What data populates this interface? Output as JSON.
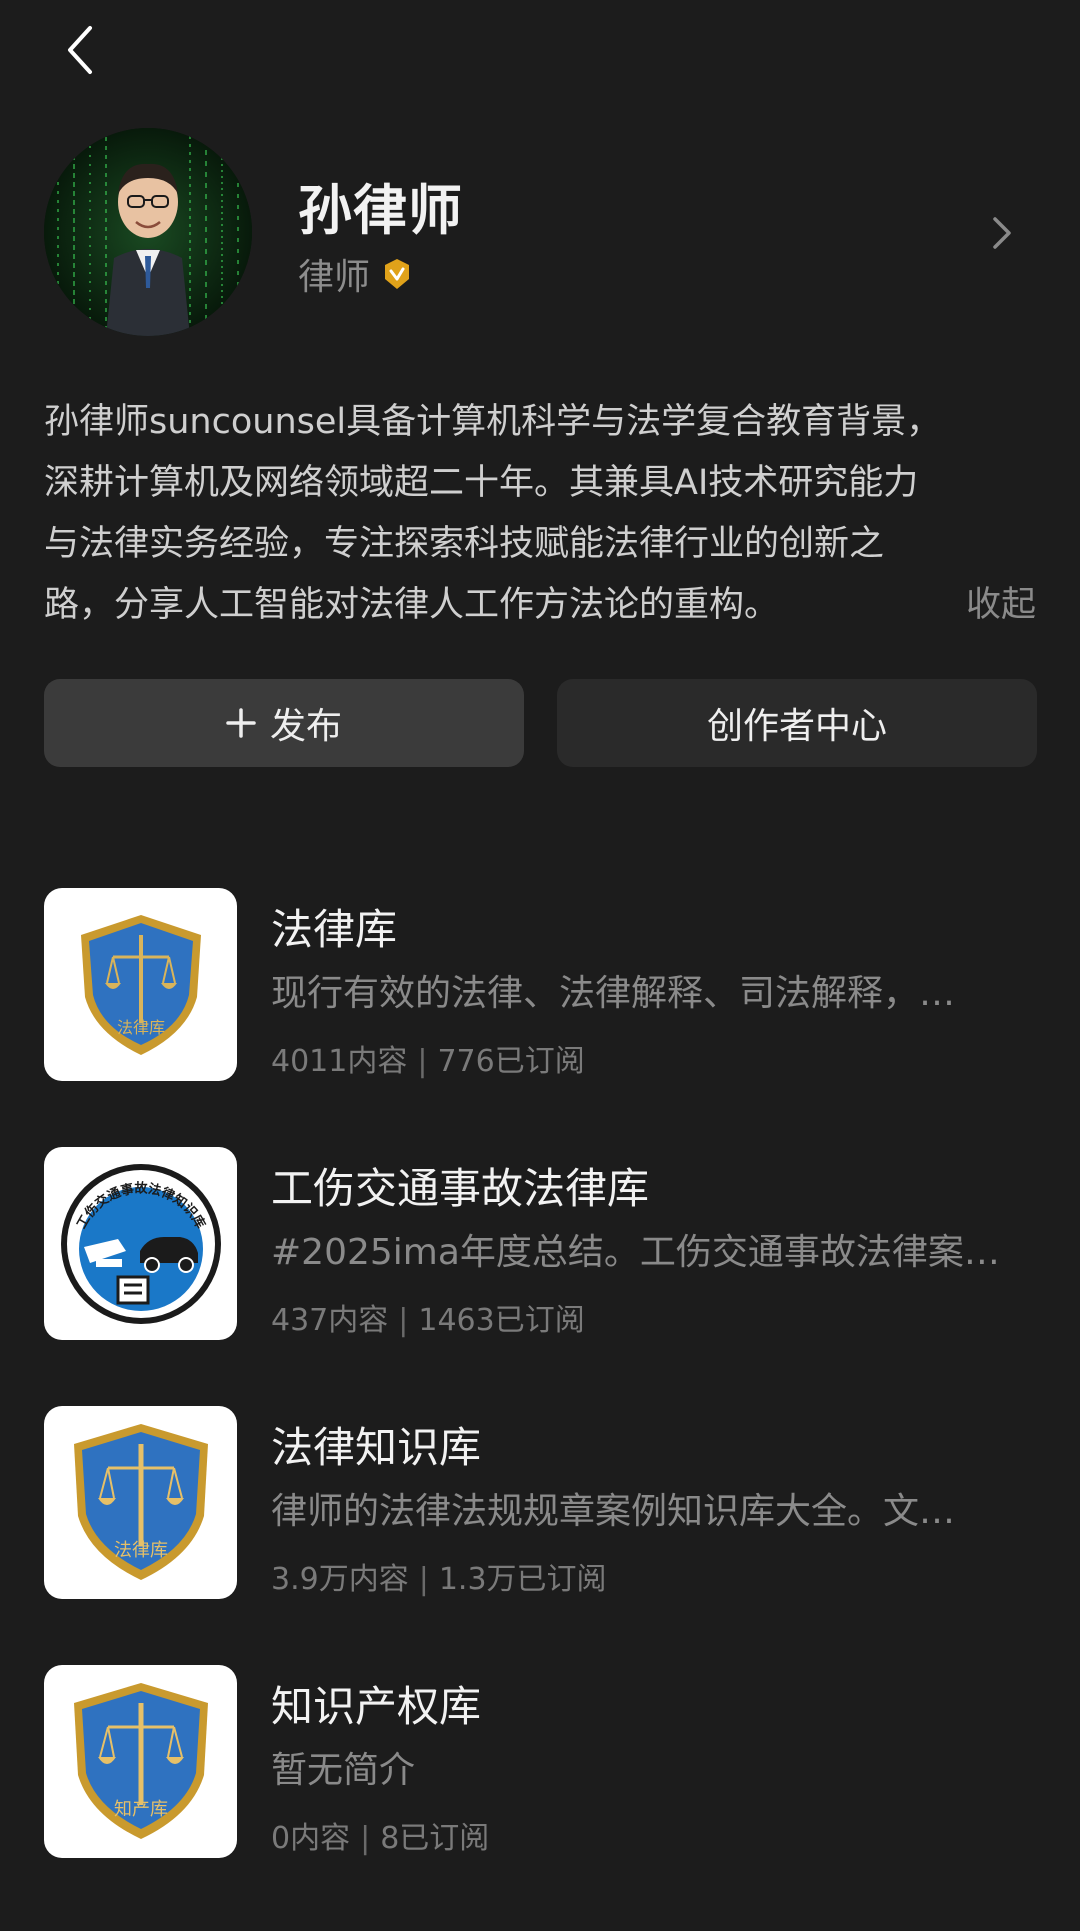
{
  "profile": {
    "name": "孙律师",
    "role": "律师",
    "icons": {
      "back": "chevron-left-icon",
      "verified": "verified-badge-icon",
      "more": "chevron-right-icon"
    },
    "colors": {
      "verified": "#e0a21a",
      "background": "#1c1c1c"
    }
  },
  "bio": {
    "lines": [
      "孙律师suncounsel具备计算机科学与法学复合教育背景，",
      "深耕计算机及网络领域超二十年。其兼具AI技术研究能力",
      "与法律实务经验，专注探索科技赋能法律行业的创新之",
      "路，分享人工智能对法律人工作方法论的重构。"
    ],
    "collapse_label": "收起"
  },
  "actions": {
    "publish_label": "发布",
    "creator_center_label": "创作者中心"
  },
  "knowledge_bases": [
    {
      "title": "法律库",
      "description": "现行有效的法律、法律解释、司法解释，…",
      "content_count": "4011内容",
      "subscribers": "776已订阅",
      "badge_text": "法律库"
    },
    {
      "title": "工伤交通事故法律库",
      "description": "#2025ima年度总结。工伤交通事故法律案…",
      "content_count": "437内容",
      "subscribers": "1463已订阅",
      "badge_text": "工伤交通事故法律知识库"
    },
    {
      "title": "法律知识库",
      "description": "律师的法律法规规章案例知识库大全。文…",
      "content_count": "3.9万内容",
      "subscribers": "1.3万已订阅",
      "badge_text": "法律库"
    },
    {
      "title": "知识产权库",
      "description": "暂无简介",
      "content_count": "0内容",
      "subscribers": "8已订阅",
      "badge_text": "知产库"
    }
  ],
  "separator": "|"
}
